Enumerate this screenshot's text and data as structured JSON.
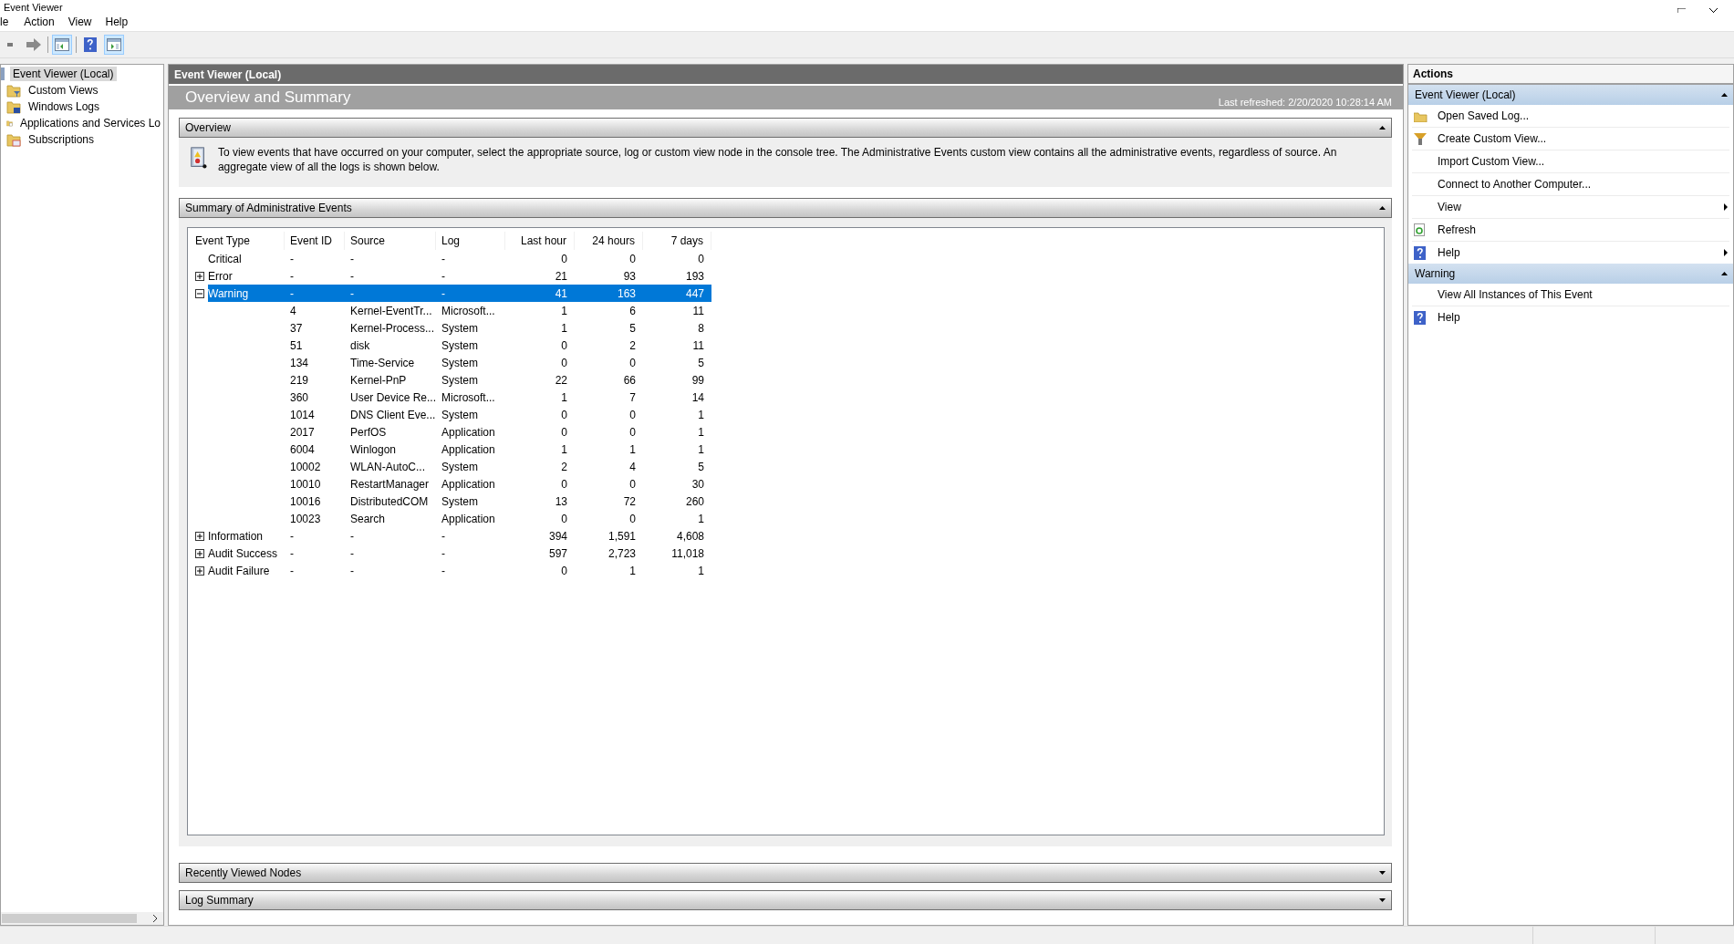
{
  "window": {
    "title": "Event Viewer"
  },
  "menu": [
    "le",
    "Action",
    "View",
    "Help"
  ],
  "toolbar": [
    {
      "pressed": false
    },
    {
      "pressed": false
    },
    {
      "pressed": true
    },
    {
      "pressed": false
    },
    {
      "pressed": true
    }
  ],
  "tree": [
    {
      "label": "Event Viewer (Local)",
      "selected": true
    },
    {
      "label": "Custom Views",
      "selected": false
    },
    {
      "label": "Windows Logs",
      "selected": false
    },
    {
      "label": "Applications and Services Lo",
      "selected": false
    },
    {
      "label": "Subscriptions",
      "selected": false
    }
  ],
  "center": {
    "pane_title": "Event Viewer (Local)",
    "title": "Overview and Summary",
    "last_refreshed": "Last refreshed: 2/20/2020 10:28:14 AM",
    "overview": {
      "title": "Overview",
      "expanded": true,
      "text": "To view events that have occurred on your computer, select the appropriate source, log or custom view node in the console tree. The Administrative Events custom view contains all the administrative events, regardless of source. An aggregate view of all the logs is shown below."
    },
    "summary": {
      "title": "Summary of Administrative Events",
      "expanded": true,
      "columns": [
        "Event Type",
        "Event ID",
        "Source",
        "Log",
        "Last hour",
        "24 hours",
        "7 days"
      ],
      "rows": [
        {
          "kind": "plain",
          "cells": [
            "Critical",
            "-",
            "-",
            "-",
            "0",
            "0",
            "0"
          ],
          "selected": false
        },
        {
          "kind": "group",
          "expanded": false,
          "cells": [
            "Error",
            "-",
            "-",
            "-",
            "21",
            "93",
            "193"
          ],
          "selected": false
        },
        {
          "kind": "group",
          "expanded": true,
          "cells": [
            "Warning",
            "-",
            "-",
            "-",
            "41",
            "163",
            "447"
          ],
          "selected": true
        },
        {
          "kind": "detail",
          "cells": [
            "",
            "4",
            "Kernel-EventTr...",
            "Microsoft...",
            "1",
            "6",
            "11"
          ],
          "selected": false
        },
        {
          "kind": "detail",
          "cells": [
            "",
            "37",
            "Kernel-Process...",
            "System",
            "1",
            "5",
            "8"
          ],
          "selected": false
        },
        {
          "kind": "detail",
          "cells": [
            "",
            "51",
            "disk",
            "System",
            "0",
            "2",
            "11"
          ],
          "selected": false
        },
        {
          "kind": "detail",
          "cells": [
            "",
            "134",
            "Time-Service",
            "System",
            "0",
            "0",
            "5"
          ],
          "selected": false
        },
        {
          "kind": "detail",
          "cells": [
            "",
            "219",
            "Kernel-PnP",
            "System",
            "22",
            "66",
            "99"
          ],
          "selected": false
        },
        {
          "kind": "detail",
          "cells": [
            "",
            "360",
            "User Device Re...",
            "Microsoft...",
            "1",
            "7",
            "14"
          ],
          "selected": false
        },
        {
          "kind": "detail",
          "cells": [
            "",
            "1014",
            "DNS Client Eve...",
            "System",
            "0",
            "0",
            "1"
          ],
          "selected": false
        },
        {
          "kind": "detail",
          "cells": [
            "",
            "2017",
            "PerfOS",
            "Application",
            "0",
            "0",
            "1"
          ],
          "selected": false
        },
        {
          "kind": "detail",
          "cells": [
            "",
            "6004",
            "Winlogon",
            "Application",
            "1",
            "1",
            "1"
          ],
          "selected": false
        },
        {
          "kind": "detail",
          "cells": [
            "",
            "10002",
            "WLAN-AutoC...",
            "System",
            "2",
            "4",
            "5"
          ],
          "selected": false
        },
        {
          "kind": "detail",
          "cells": [
            "",
            "10010",
            "RestartManager",
            "Application",
            "0",
            "0",
            "30"
          ],
          "selected": false
        },
        {
          "kind": "detail",
          "cells": [
            "",
            "10016",
            "DistributedCOM",
            "System",
            "13",
            "72",
            "260"
          ],
          "selected": false
        },
        {
          "kind": "detail",
          "cells": [
            "",
            "10023",
            "Search",
            "Application",
            "0",
            "0",
            "1"
          ],
          "selected": false
        },
        {
          "kind": "group",
          "expanded": false,
          "cells": [
            "Information",
            "-",
            "-",
            "-",
            "394",
            "1,591",
            "4,608"
          ],
          "selected": false
        },
        {
          "kind": "group",
          "expanded": false,
          "cells": [
            "Audit Success",
            "-",
            "-",
            "-",
            "597",
            "2,723",
            "11,018"
          ],
          "selected": false
        },
        {
          "kind": "group",
          "expanded": false,
          "cells": [
            "Audit Failure",
            "-",
            "-",
            "-",
            "0",
            "1",
            "1"
          ],
          "selected": false
        }
      ]
    },
    "bottom_sections": [
      {
        "title": "Recently Viewed Nodes",
        "expanded": false
      },
      {
        "title": "Log Summary",
        "expanded": false
      }
    ]
  },
  "actions": {
    "title": "Actions",
    "sections": [
      {
        "title": "Event Viewer (Local)",
        "expanded": true,
        "items": [
          {
            "label": "Open Saved Log...",
            "submenu": false
          },
          {
            "label": "Create Custom View...",
            "submenu": false
          },
          {
            "label": "Import Custom View...",
            "submenu": false
          },
          {
            "label": "Connect to Another Computer...",
            "submenu": false
          },
          {
            "label": "View",
            "submenu": true
          },
          {
            "label": "Refresh",
            "submenu": false
          },
          {
            "label": "Help",
            "submenu": true
          }
        ]
      },
      {
        "title": "Warning",
        "expanded": true,
        "items": [
          {
            "label": "View All Instances of This Event",
            "submenu": false
          },
          {
            "label": "Help",
            "submenu": false
          }
        ]
      }
    ]
  }
}
